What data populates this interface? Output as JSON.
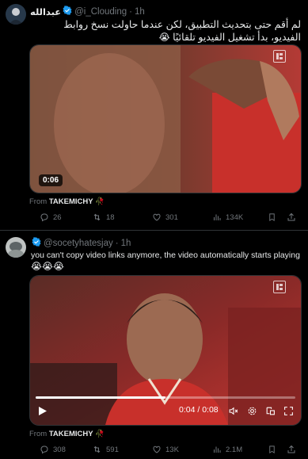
{
  "post1": {
    "display_name": "عبدالله",
    "handle": "@i_Clouding",
    "separator": "·",
    "time": "1h",
    "text": "لم أقم حتى بتحديث التطبيق، لكن عندما حاولت نسخ روابط الفيديو، بدأ تشغيل الفيديو تلقائيًا",
    "text_emoji": "😭",
    "video_duration": "0:06",
    "from_prefix": "From",
    "from_account": "TAKEMICHY",
    "from_emoji": "🥀",
    "stats": {
      "replies": "26",
      "reposts": "18",
      "likes": "301",
      "views": "134K"
    }
  },
  "post2": {
    "handle": "@socetyhatesjay",
    "separator": "·",
    "time": "1h",
    "text": "you can't copy video links anymore, the video automatically starts playing",
    "text_emoji": "😭😭😭",
    "video_time": "0:04 / 0:08",
    "video_progress": 0.5,
    "from_prefix": "From",
    "from_account": "TAKEMICHY",
    "from_emoji": "🥀",
    "stats": {
      "replies": "308",
      "reposts": "591",
      "likes": "13K",
      "views": "2.1M"
    }
  },
  "colors": {
    "background": "#000000",
    "text": "#e7e9ea",
    "muted": "#71767b",
    "verified": "#1d9bf0",
    "divider": "#2f3336"
  }
}
